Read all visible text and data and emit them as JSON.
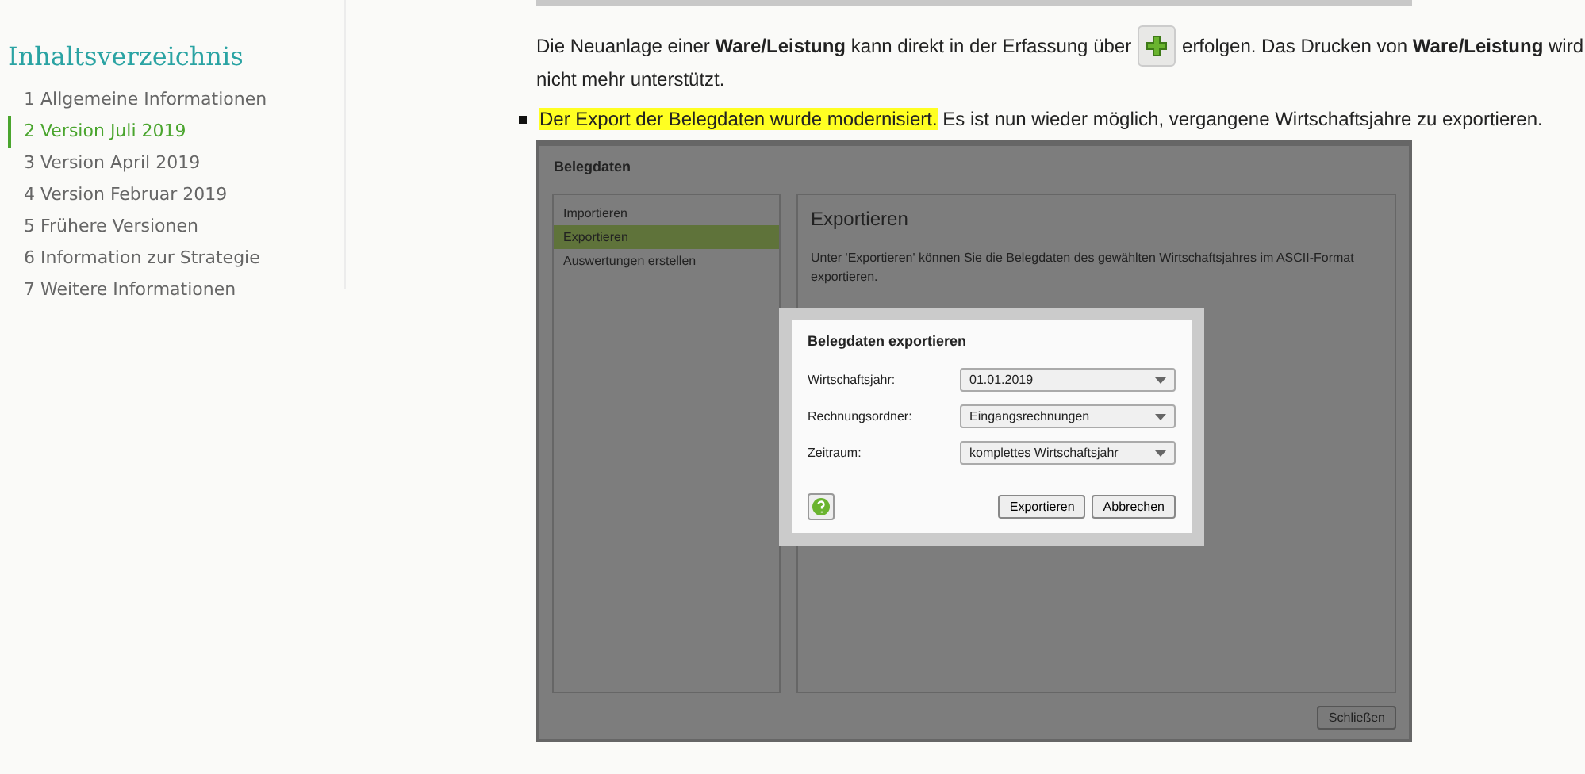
{
  "toc": {
    "title": "Inhaltsverzeichnis",
    "items": [
      {
        "label": "1 Allgemeine Informationen",
        "selected": false
      },
      {
        "label": "2 Version Juli 2019",
        "selected": true
      },
      {
        "label": "3 Version April 2019",
        "selected": false
      },
      {
        "label": "4 Version Februar 2019",
        "selected": false
      },
      {
        "label": "5 Frühere Versionen",
        "selected": false
      },
      {
        "label": "6 Information zur Strategie",
        "selected": false
      },
      {
        "label": "7 Weitere Informationen",
        "selected": false
      }
    ]
  },
  "paragraph": {
    "before": "Die Neuanlage einer **Ware/Leistung** kann direkt in der Erfassung über",
    "after": "erfolgen. Das Drucken von **Ware/Leistung** wird",
    "continuation": "nicht mehr unterstützt."
  },
  "bullet": {
    "highlighted": "Der Export der Belegdaten wurde modernisiert.",
    "text": "Es ist nun wieder möglich, vergangene Wirtschaftsjahre zu exportieren."
  },
  "screenshot": {
    "title": "Belegdaten",
    "nav": [
      {
        "label": "Importieren",
        "selected": false
      },
      {
        "label": "Exportieren",
        "selected": true
      },
      {
        "label": "Auswertungen erstellen",
        "selected": false
      }
    ],
    "heading": "Exportieren",
    "description": "Unter 'Exportieren' können Sie die Belegdaten des gewählten Wirtschaftsjahres im ASCII-Format exportieren.",
    "close_button": "Schließen",
    "dialog": {
      "title": "Belegdaten exportieren",
      "fields": [
        {
          "label": "Wirtschaftsjahr:",
          "value": "01.01.2019"
        },
        {
          "label": "Rechnungsordner:",
          "value": "Eingangsrechnungen"
        },
        {
          "label": "Zeitraum:",
          "value": "komplettes Wirtschaftsjahr"
        }
      ],
      "buttons": [
        "Exportieren",
        "Abbrechen"
      ]
    }
  }
}
